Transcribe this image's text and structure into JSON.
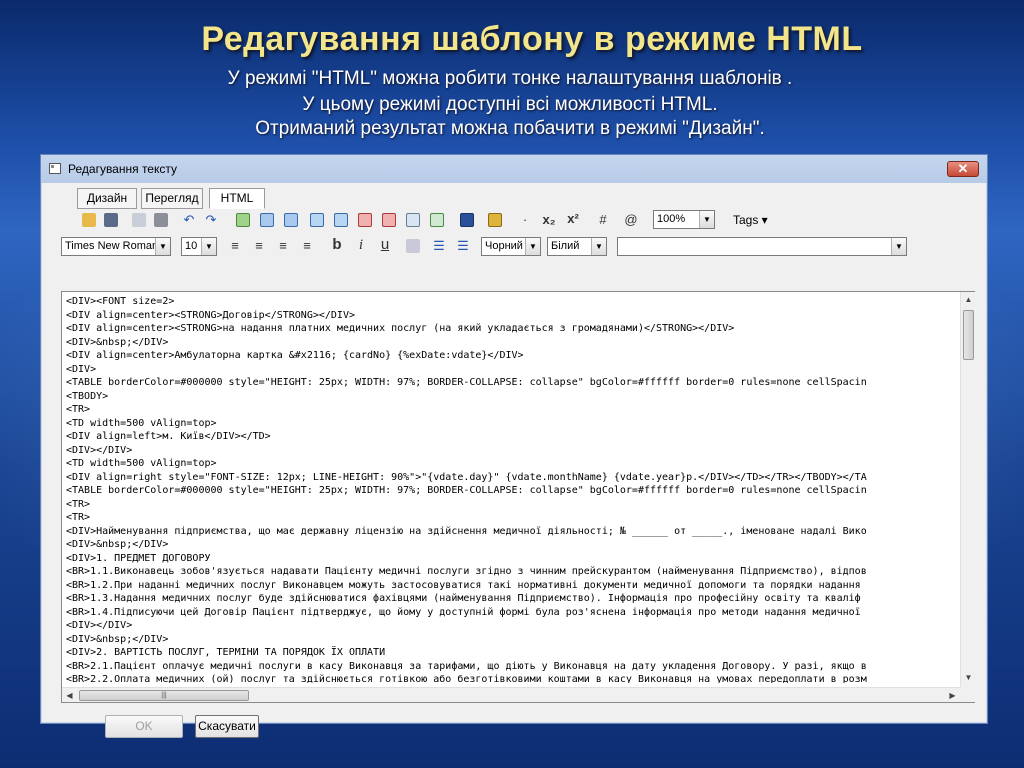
{
  "slide": {
    "title": "Редагування шаблону в режиме HTML",
    "subtitle_lines": [
      "У режимі \"HTML\" можна робити тонке налаштування шаблонів .",
      "У цьому режимі доступні всі можливості HTML.",
      "Отриманий результат можна побачити в режимі \"Дизайн\"."
    ]
  },
  "window": {
    "title": "Редагування тексту",
    "close_label": "✕"
  },
  "tabs": [
    {
      "label": "Дизайн"
    },
    {
      "label": "Перегляд"
    },
    {
      "label": "HTML",
      "active": true
    }
  ],
  "toolbar1": {
    "zoom": "100%",
    "tags_label": "Tags ▾",
    "subscript_label": "x₂",
    "superscript_label": "x²",
    "hash_label": "#",
    "at_label": "@",
    "dot_label": "·"
  },
  "toolbar2": {
    "font_family": "Times New Roman",
    "font_size": "10",
    "bold": "b",
    "italic": "i",
    "underline": "u",
    "fore_color": "Чорний",
    "back_color": "Білий",
    "style_value": ""
  },
  "editor": {
    "lines": [
      "<DIV><FONT size=2>",
      "<DIV align=center><STRONG>Договір</STRONG></DIV>",
      "<DIV align=center><STRONG>на надання платних медичних послуг (на який укладається з громадянами)</STRONG></DIV>",
      "<DIV>&nbsp;</DIV>",
      "<DIV align=center>Амбулаторна картка &#x2116; {cardNo} {%exDate:vdate}</DIV>",
      "<DIV>",
      "<TABLE borderColor=#000000 style=\"HEIGHT: 25px; WIDTH: 97%; BORDER-COLLAPSE: collapse\" bgColor=#ffffff border=0 rules=none cellSpacin",
      "<TBODY>",
      "<TR>",
      "<TD width=500 vAlign=top>",
      "<DIV align=left>м. Київ</DIV></TD>",
      "<DIV></DIV>",
      "<TD width=500 vAlign=top>",
      "<DIV align=right style=\"FONT-SIZE: 12px; LINE-HEIGHT: 90%\">\"{vdate.day}\" {vdate.monthName} {vdate.year}р.</DIV></TD></TR></TBODY></TA",
      "<TABLE borderColor=#000000 style=\"HEIGHT: 25px; WIDTH: 97%; BORDER-COLLAPSE: collapse\" bgColor=#ffffff border=0 rules=none cellSpacin",
      "<TR>",
      "<TR>",
      "<DIV>Найменування підприємства, що має державну ліцензію на здійснення медичної діяльності; № ______ от _____., іменоване надалі Вико",
      "<DIV>&nbsp;</DIV>",
      "<DIV>1. ПРЕДМЕТ ДОГОВОРУ",
      "<BR>1.1.Виконавець зобов'язується надавати Пацієнту медичні послуги згідно з чинним прейскурантом (найменування Підприємство), відпов",
      "<BR>1.2.При наданні медичних послуг Виконавцем можуть застосовуватися такі нормативні документи медичної допомоги та порядки надання",
      "<BR>1.3.Надання медичних послуг буде здійснюватися фахівцями (найменування Підприємство). Інформація про професійну освіту та кваліф",
      "<BR>1.4.Підписуючи цей Договір Пацієнт підтверджує, що йому у доступній формі була роз'яснена інформація про методи надання медичної",
      "<DIV></DIV>",
      "<DIV>&nbsp;</DIV>",
      "<DIV>2. ВАРТІСТЬ ПОСЛУГ, ТЕРМІНИ ТА ПОРЯДОК ЇХ ОПЛАТИ",
      "<BR>2.1.Пацієнт оплачує медичні послуги в касу Виконавця за тарифами, що діють у Виконавця на дату укладення Договору. У разі, якщо в",
      "<BR>2.2.Оплата медичних (ой) послуг та здійснюється готівкою або безготівковими коштами в касу Виконавця на умовах передоплати в розм"
    ]
  },
  "buttons": {
    "ok": "OK",
    "cancel": "Скасувати"
  }
}
